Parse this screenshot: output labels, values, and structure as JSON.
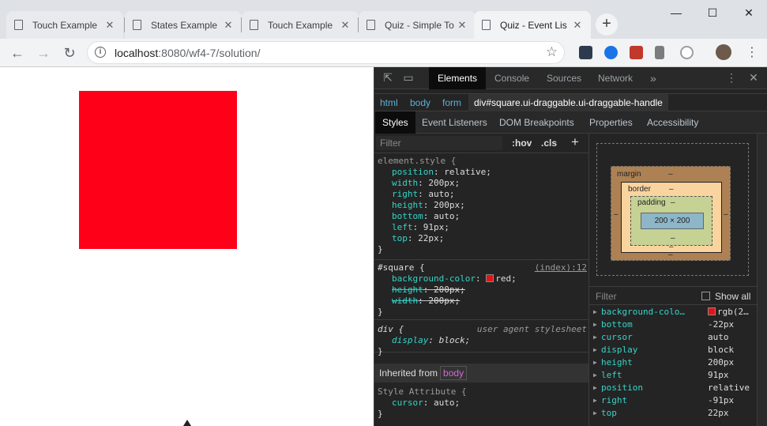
{
  "browser": {
    "tabs": [
      {
        "title": "Touch Example",
        "active": false
      },
      {
        "title": "States Example",
        "active": false
      },
      {
        "title": "Touch Example",
        "active": false
      },
      {
        "title": "Quiz - Simple To",
        "active": false
      },
      {
        "title": "Quiz - Event Lis",
        "active": true
      }
    ],
    "new_tab": "+",
    "close_glyph": "✕",
    "window_controls": [
      "—",
      "☐",
      "✕"
    ],
    "url_host": "localhost",
    "url_rest": ":8080/wf4-7/solution/",
    "extension_colors": [
      "#2e3b4e",
      "#1b73e8",
      "#c0392b",
      "#7c7c7c",
      "#9e9e9e"
    ]
  },
  "page": {
    "square_color": "#ff0019"
  },
  "devtools": {
    "main_tabs": [
      "Elements",
      "Console",
      "Sources",
      "Network"
    ],
    "more": "»",
    "breadcrumbs": [
      "html",
      "body",
      "form",
      "div#square.ui-draggable.ui-draggable-handle"
    ],
    "sub_tabs": [
      "Styles",
      "Event Listeners",
      "DOM Breakpoints",
      "Properties",
      "Accessibility"
    ],
    "filter_placeholder": "Filter",
    "hov": ":hov",
    "cls": ".cls",
    "plus": "+",
    "element_style": {
      "selector": "element.style {",
      "props": [
        {
          "name": "position",
          "value": "relative;"
        },
        {
          "name": "width",
          "value": "200px;"
        },
        {
          "name": "right",
          "value": "auto;"
        },
        {
          "name": "height",
          "value": "200px;"
        },
        {
          "name": "bottom",
          "value": "auto;"
        },
        {
          "name": "left",
          "value": "91px;"
        },
        {
          "name": "top",
          "value": "22px;"
        }
      ],
      "close": "}"
    },
    "square_rule": {
      "selector": "#square {",
      "source": "(index):12",
      "props": [
        {
          "name": "background-color",
          "value": "red;"
        },
        {
          "name": "height",
          "value": "200px;"
        },
        {
          "name": "width",
          "value": "200px;"
        }
      ],
      "close": "}"
    },
    "div_rule": {
      "selector": "div {",
      "source": "user agent stylesheet",
      "props": [
        {
          "name": "display",
          "value": "block;"
        }
      ],
      "close": "}"
    },
    "inherited": {
      "label": "Inherited from",
      "tag": "body"
    },
    "style_attr": {
      "selector": "Style Attribute {",
      "props": [
        {
          "name": "cursor",
          "value": "auto;"
        }
      ],
      "close": "}"
    },
    "box_model": {
      "margin_label": "margin",
      "border_label": "border",
      "padding_label": "padding",
      "dash": "–",
      "content_size": "200 × 200"
    },
    "computed_filter": "Filter",
    "show_all": "Show all",
    "computed": [
      {
        "name": "background-colo…",
        "value": "rgb(2…",
        "swatch": true
      },
      {
        "name": "bottom",
        "value": "-22px"
      },
      {
        "name": "cursor",
        "value": "auto"
      },
      {
        "name": "display",
        "value": "block"
      },
      {
        "name": "height",
        "value": "200px"
      },
      {
        "name": "left",
        "value": "91px"
      },
      {
        "name": "position",
        "value": "relative"
      },
      {
        "name": "right",
        "value": "-91px"
      },
      {
        "name": "top",
        "value": "22px"
      }
    ]
  }
}
